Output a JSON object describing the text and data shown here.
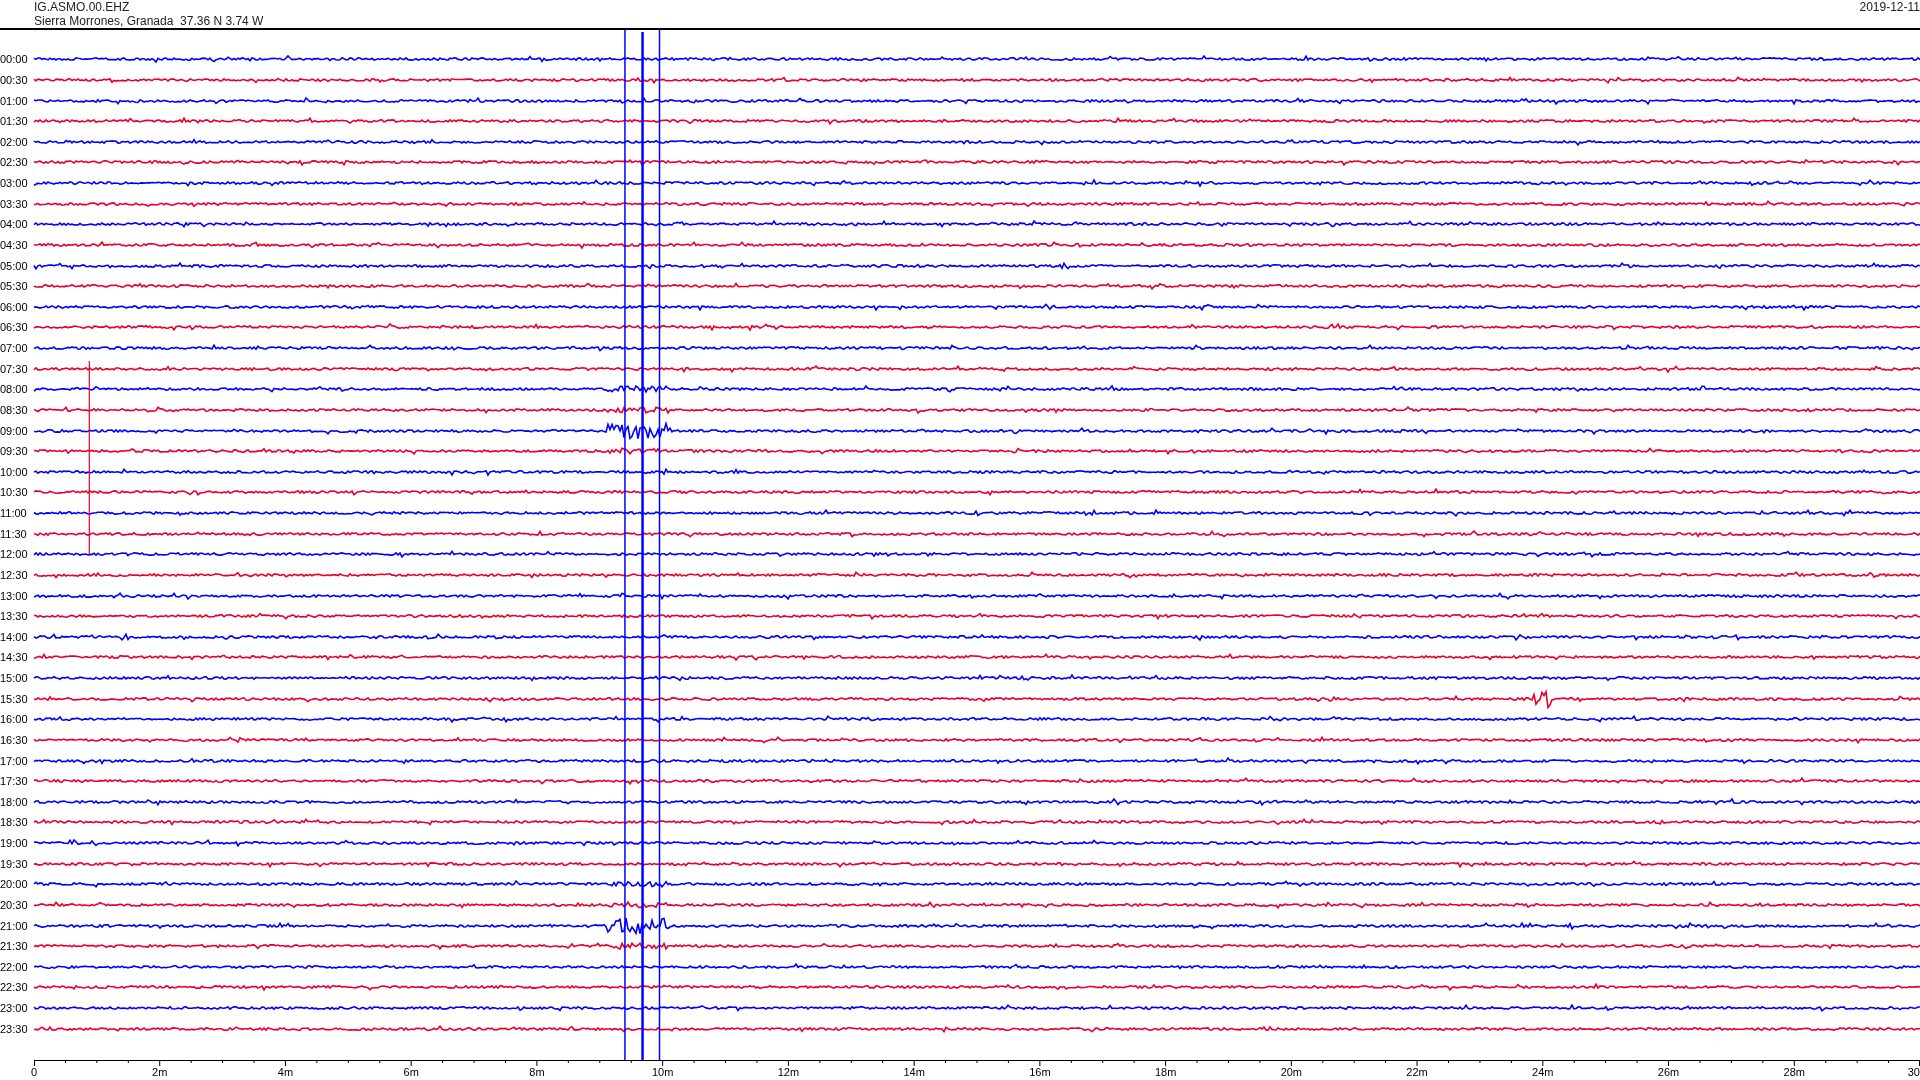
{
  "header": {
    "station": "IG.ASMO.00.EHZ",
    "location": "Sierra Morrones, Granada  37.36 N 3.74 W",
    "date": "2019-12-11"
  },
  "traces": [
    {
      "time": "00:00",
      "color": "#0000ff"
    },
    {
      "time": "00:30",
      "color": "#e8002a"
    },
    {
      "time": "01:00",
      "color": "#0000ff"
    },
    {
      "time": "01:30",
      "color": "#e8002a"
    },
    {
      "time": "02:00",
      "color": "#0000ff"
    },
    {
      "time": "02:30",
      "color": "#e8002a"
    },
    {
      "time": "03:00",
      "color": "#0000ff"
    },
    {
      "time": "03:30",
      "color": "#e8002a"
    },
    {
      "time": "04:00",
      "color": "#0000ff"
    },
    {
      "time": "04:30",
      "color": "#e8002a"
    },
    {
      "time": "05:00",
      "color": "#0000ff"
    },
    {
      "time": "05:30",
      "color": "#e8002a"
    },
    {
      "time": "06:00",
      "color": "#0000ff"
    },
    {
      "time": "06:30",
      "color": "#e8002a"
    },
    {
      "time": "07:00",
      "color": "#0000ff"
    },
    {
      "time": "07:30",
      "color": "#e8002a"
    },
    {
      "time": "08:00",
      "color": "#0000ff"
    },
    {
      "time": "08:30",
      "color": "#e8002a"
    },
    {
      "time": "09:00",
      "color": "#0000ff"
    },
    {
      "time": "09:30",
      "color": "#e8002a"
    },
    {
      "time": "10:00",
      "color": "#0000ff"
    },
    {
      "time": "10:30",
      "color": "#e8002a"
    },
    {
      "time": "11:00",
      "color": "#0000ff"
    },
    {
      "time": "11:30",
      "color": "#e8002a"
    },
    {
      "time": "12:00",
      "color": "#0000ff"
    },
    {
      "time": "12:30",
      "color": "#e8002a"
    },
    {
      "time": "13:00",
      "color": "#0000ff"
    },
    {
      "time": "13:30",
      "color": "#e8002a"
    },
    {
      "time": "14:00",
      "color": "#0000ff"
    },
    {
      "time": "14:30",
      "color": "#e8002a"
    },
    {
      "time": "15:00",
      "color": "#0000ff"
    },
    {
      "time": "15:30",
      "color": "#e8002a"
    },
    {
      "time": "16:00",
      "color": "#0000ff"
    },
    {
      "time": "16:30",
      "color": "#e8002a"
    },
    {
      "time": "17:00",
      "color": "#0000ff"
    },
    {
      "time": "17:30",
      "color": "#e8002a"
    },
    {
      "time": "18:00",
      "color": "#0000ff"
    },
    {
      "time": "18:30",
      "color": "#e8002a"
    },
    {
      "time": "19:00",
      "color": "#0000ff"
    },
    {
      "time": "19:30",
      "color": "#e8002a"
    },
    {
      "time": "20:00",
      "color": "#0000ff"
    },
    {
      "time": "20:30",
      "color": "#e8002a"
    },
    {
      "time": "21:00",
      "color": "#0000ff"
    },
    {
      "time": "21:30",
      "color": "#e8002a"
    },
    {
      "time": "22:00",
      "color": "#0000ff"
    },
    {
      "time": "22:30",
      "color": "#e8002a"
    },
    {
      "time": "23:00",
      "color": "#0000ff"
    },
    {
      "time": "23:30",
      "color": "#e8002a"
    }
  ],
  "x_axis": {
    "ticks": [
      "0",
      "2m",
      "4m",
      "6m",
      "8m",
      "10m",
      "12m",
      "14m",
      "16m",
      "18m",
      "20m",
      "22m",
      "24m",
      "26m",
      "28m",
      "30"
    ]
  }
}
